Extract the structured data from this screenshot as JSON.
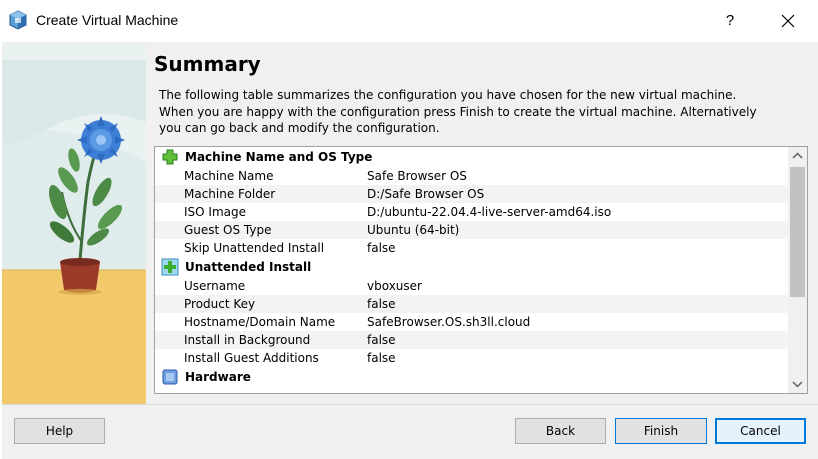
{
  "window": {
    "title": "Create Virtual Machine",
    "help_glyph": "?",
    "close_glyph": "close"
  },
  "page": {
    "heading": "Summary",
    "description": "The following table summarizes the configuration you have chosen for the new virtual machine. When you are happy with the configuration press Finish to create the virtual machine. Alternatively you can go back and modify the configuration."
  },
  "summary": {
    "machine": {
      "title": "Machine Name and OS Type",
      "icon": "green-puzzle-icon",
      "rows": [
        {
          "key": "Machine Name",
          "value": "Safe Browser OS"
        },
        {
          "key": "Machine Folder",
          "value": "D:/Safe Browser OS"
        },
        {
          "key": "ISO Image",
          "value": "D:/ubuntu-22.04.4-live-server-amd64.iso"
        },
        {
          "key": "Guest OS Type",
          "value": "Ubuntu (64-bit)"
        },
        {
          "key": "Skip Unattended Install",
          "value": "false"
        }
      ]
    },
    "unattended": {
      "title": "Unattended Install",
      "icon": "green-plus-icon",
      "rows": [
        {
          "key": "Username",
          "value": "vboxuser"
        },
        {
          "key": "Product Key",
          "value": "false"
        },
        {
          "key": "Hostname/Domain Name",
          "value": "SafeBrowser.OS.sh3ll.cloud"
        },
        {
          "key": "Install in Background",
          "value": "false"
        },
        {
          "key": "Install Guest Additions",
          "value": "false"
        }
      ]
    },
    "hardware": {
      "title": "Hardware",
      "icon": "chip-icon"
    }
  },
  "buttons": {
    "help": "Help",
    "back": "Back",
    "finish": "Finish",
    "cancel": "Cancel"
  },
  "colors": {
    "accent": "#0078d7",
    "art_yellow": "#f2c96b",
    "art_teal": "#cfe2e2"
  }
}
